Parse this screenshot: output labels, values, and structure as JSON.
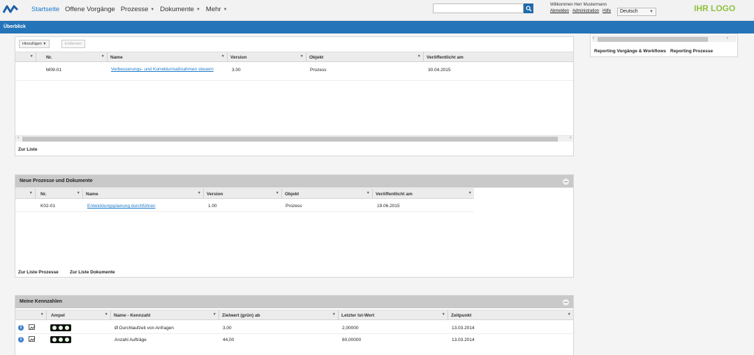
{
  "header": {
    "nav": [
      {
        "label": "Startseite",
        "active": true,
        "dropdown": false
      },
      {
        "label": "Offene Vorgänge",
        "active": false,
        "dropdown": false
      },
      {
        "label": "Prozesse",
        "active": false,
        "dropdown": true
      },
      {
        "label": "Dokumente",
        "active": false,
        "dropdown": true
      },
      {
        "label": "Mehr",
        "active": false,
        "dropdown": true
      }
    ],
    "search_placeholder": "",
    "welcome": "Willkommen Herr Mustermann",
    "user_links": [
      "Abmelden",
      "Administration",
      "Hilfe"
    ],
    "language": "Deutsch",
    "brand": "IHR LOGO"
  },
  "breadcrumb": "Überblick",
  "right_panel": {
    "tabs": [
      "Reporting Vorgänge & Workflows",
      "Reporting Prozesse"
    ]
  },
  "panel1": {
    "toolbar": {
      "add": "Hinzufügen",
      "remove": "Entfernen"
    },
    "columns": [
      "Nr.",
      "Name",
      "Version",
      "Objekt",
      "Veröffentlicht am"
    ],
    "rows": [
      {
        "nr": "M09-01",
        "name": "Verbesserungs- und Korrekturmaßnahmen steuern",
        "version": "3.00",
        "objekt": "Prozess",
        "date": "30.04.2015"
      }
    ],
    "footer": "Zur Liste"
  },
  "panel2": {
    "title": "Neue Prozesse und Dokumente",
    "columns": [
      "Nr.",
      "Name",
      "Version",
      "Objekt",
      "Veröffentlicht am"
    ],
    "rows": [
      {
        "nr": "K02-01",
        "name": "Entwicklungsplanung durchführen",
        "version": "1.00",
        "objekt": "Prozess",
        "date": "19.06.2015"
      }
    ],
    "footer_links": [
      "Zur Liste Prozesse",
      "Zur Liste Dokumente"
    ]
  },
  "panel3": {
    "title": "Meine Kennzahlen",
    "columns": [
      "Ampel",
      "Name - Kennzahl",
      "Zielwert (grün) ab",
      "Letzter Ist-Wert",
      "Zeitpunkt"
    ],
    "rows": [
      {
        "name": "Ø Durchlaufzeit von Anfragen",
        "target": "3,00",
        "last": "2,00000",
        "date": "13.03.2014"
      },
      {
        "name": "Anzahl Aufträge",
        "target": "44,00",
        "last": "60,00000",
        "date": "13.03.2014"
      }
    ]
  },
  "colors": {
    "primary": "#2374b8",
    "brand": "#8fc23f",
    "link": "#1a78c8"
  }
}
